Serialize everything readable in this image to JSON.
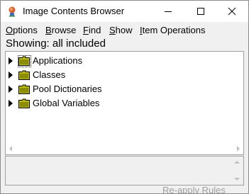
{
  "window": {
    "title": "Image Contents Browser",
    "app_icon": "pharo-icon"
  },
  "menu": {
    "items": [
      {
        "label": "Options",
        "underline": "O"
      },
      {
        "label": "Browse",
        "underline": "B"
      },
      {
        "label": "Find",
        "underline": "F"
      },
      {
        "label": "Show",
        "underline": "S"
      },
      {
        "label": "Item Operations",
        "underline": "I"
      }
    ]
  },
  "status": {
    "showing": "Showing: all included"
  },
  "tree": {
    "rows": [
      {
        "label": "Applications",
        "icon": "folder-icon",
        "expander": "collapsed"
      },
      {
        "label": "Classes",
        "icon": "folder-icon",
        "expander": "collapsed"
      },
      {
        "label": "Pool Dictionaries",
        "icon": "folder-icon",
        "expander": "collapsed"
      },
      {
        "label": "Global Variables",
        "icon": "folder-icon",
        "expander": "collapsed"
      }
    ]
  },
  "footer": {
    "reapply_label": "Re-apply Rules"
  },
  "colors": {
    "folder_fill": "#bdbd00",
    "folder_dark": "#6b6b00",
    "pane_border": "#a0a0a0",
    "disabled_text": "#a0a0a0"
  }
}
